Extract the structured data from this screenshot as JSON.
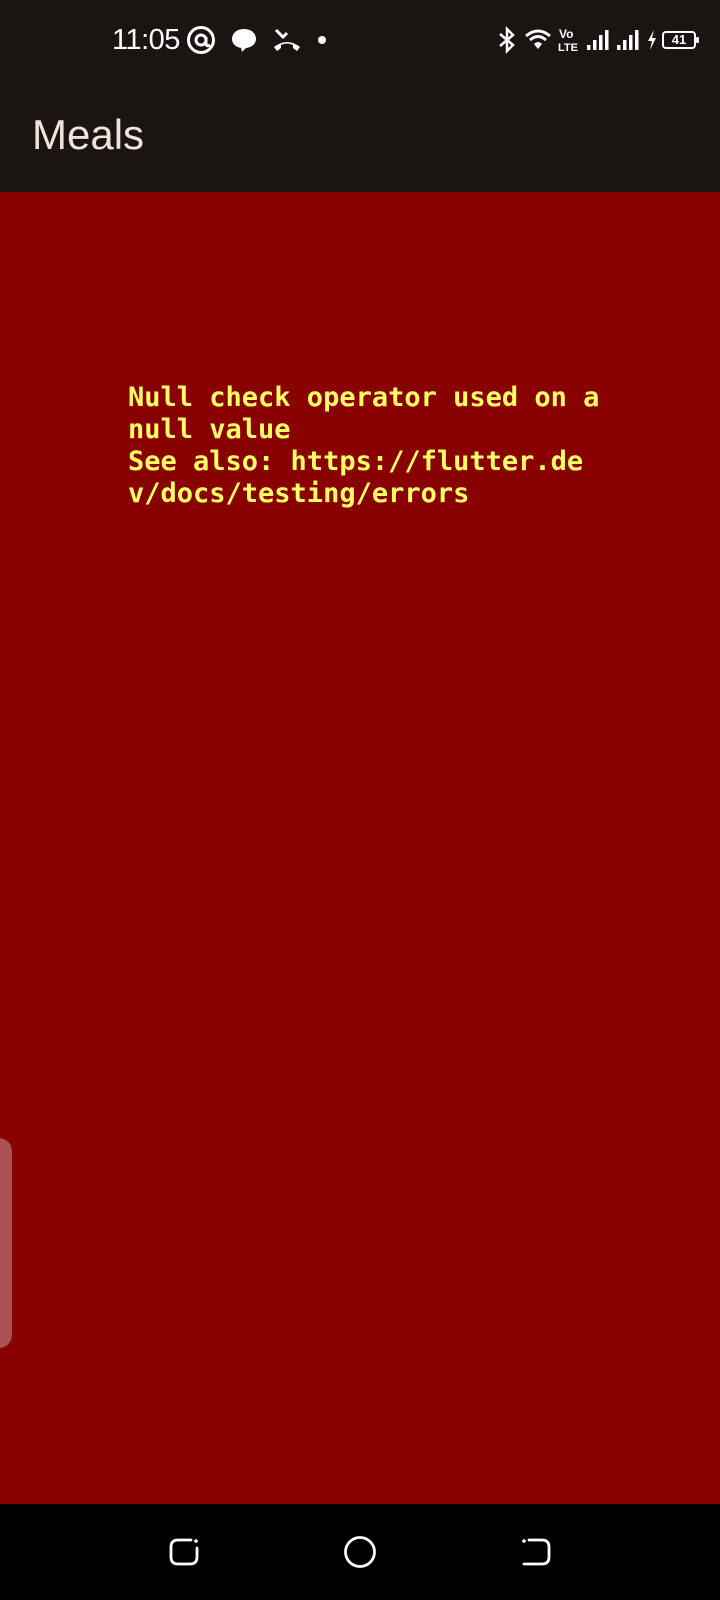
{
  "status_bar": {
    "time": "11:05",
    "battery_level": "41",
    "left_icons": [
      "at-sign-icon",
      "chat-bubble-icon",
      "missed-call-icon",
      "dot-icon"
    ],
    "right_icons": [
      "bluetooth-icon",
      "wifi-icon",
      "volte-icon",
      "signal-icon",
      "signal-icon",
      "charging-icon",
      "battery-icon"
    ],
    "volte_label": "Vo LTE"
  },
  "app_bar": {
    "title": "Meals"
  },
  "error": {
    "message": "Null check operator used on a null value\nSee also: https://flutter.dev/docs/testing/errors"
  },
  "nav_bar": {
    "buttons": [
      "recent-apps-icon",
      "home-icon",
      "back-icon"
    ]
  },
  "colors": {
    "bar_background": "#1a1512",
    "error_background": "#890000",
    "error_text": "#ffff66",
    "title_text": "#f1e2da"
  }
}
